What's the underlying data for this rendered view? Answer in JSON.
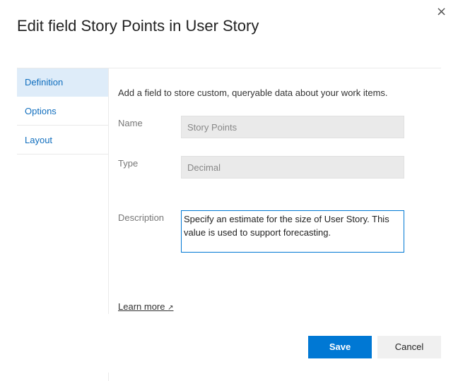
{
  "dialog": {
    "title": "Edit field Story Points in User Story",
    "close_icon": "×"
  },
  "nav": [
    {
      "label": "Definition",
      "selected": true
    },
    {
      "label": "Options"
    },
    {
      "label": "Layout"
    }
  ],
  "definition": {
    "intro": "Add a field to store custom, queryable data about your work items.",
    "name_label": "Name",
    "name_value": "Story Points",
    "type_label": "Type",
    "type_value": "Decimal",
    "description_label": "Description",
    "description_value": "Specify an estimate for the size of User Story. This value is used to support forecasting.",
    "learn_more": "Learn more",
    "external_icon": "↗"
  },
  "buttons": {
    "save": "Save",
    "cancel": "Cancel"
  },
  "colors": {
    "accent": "#0078d4",
    "nav_selected": "#deecf9"
  }
}
